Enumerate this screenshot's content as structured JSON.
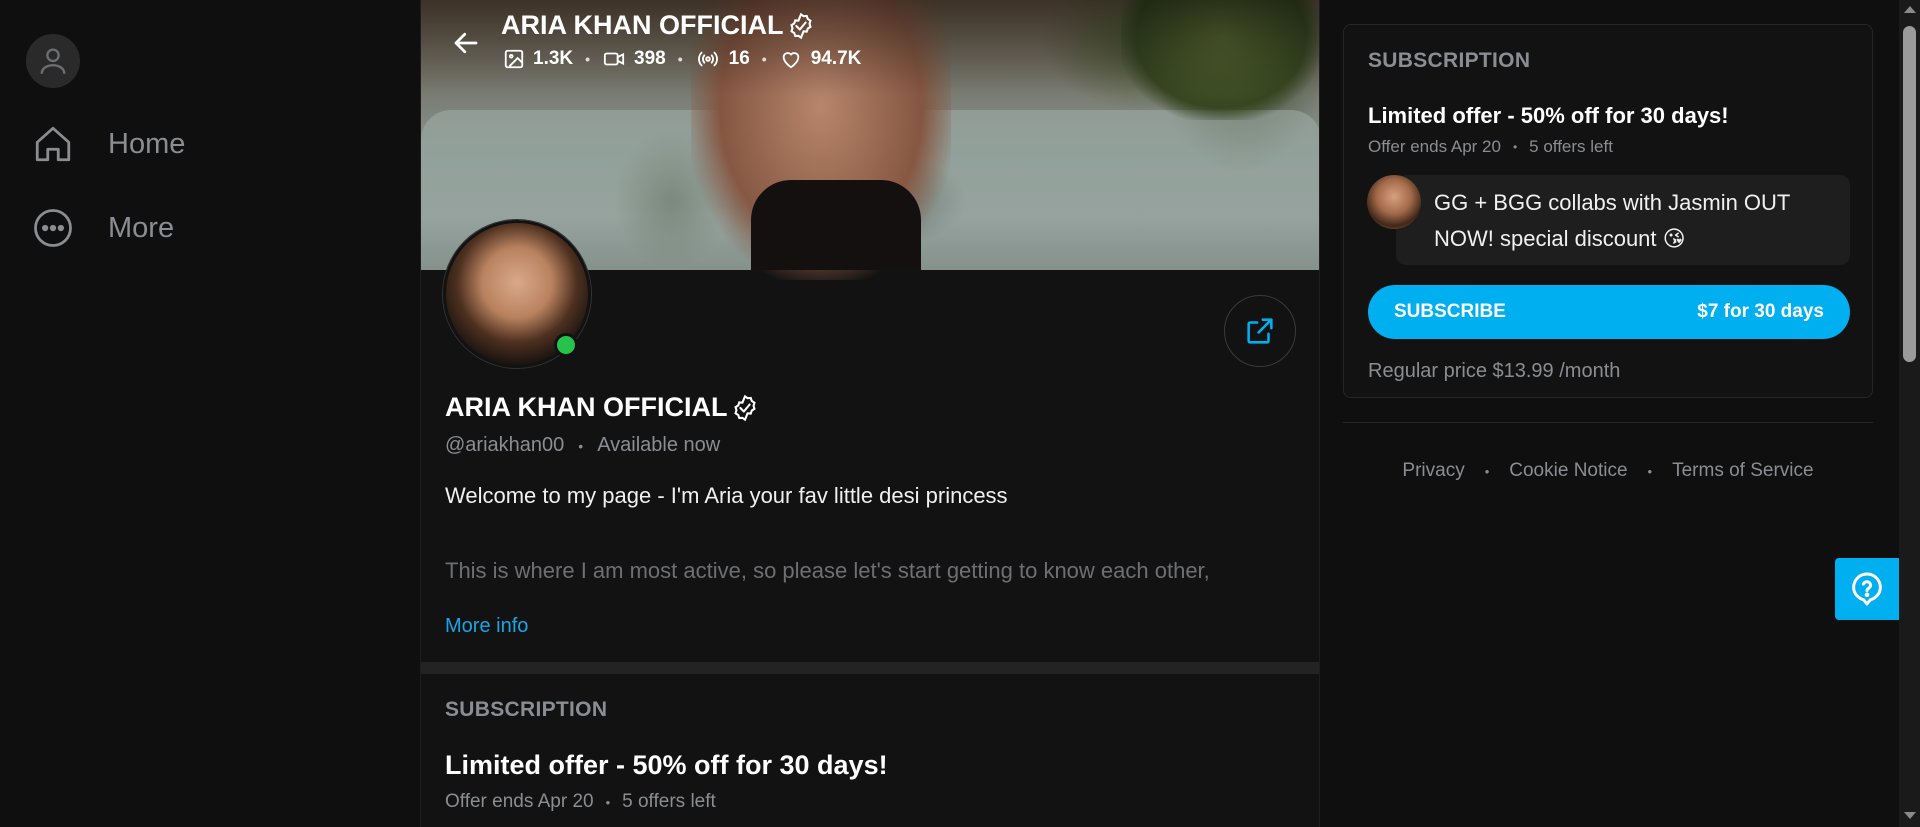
{
  "sidebar": {
    "items": [
      {
        "label": "Home",
        "icon": "home-icon"
      },
      {
        "label": "More",
        "icon": "more-icon"
      }
    ]
  },
  "profile": {
    "name": "ARIA KHAN OFFICIAL",
    "handle": "@ariakhan00",
    "status": "Available now",
    "stats": {
      "photos": "1.3K",
      "videos": "398",
      "streams": "16",
      "likes": "94.7K"
    },
    "bio_line1": "Welcome to my page - I'm Aria your fav little desi princess",
    "bio_line2": "This is where I am most active, so please let's start getting to know each other,",
    "more_info": "More info"
  },
  "subscription": {
    "heading": "SUBSCRIPTION",
    "offer_title": "Limited offer - 50% off for 30 days!",
    "offer_ends": "Offer ends Apr 20",
    "offers_left": "5 offers left",
    "promo_message": "GG + BGG collabs with Jasmin OUT NOW! special discount 😘",
    "subscribe_label": "SUBSCRIBE",
    "subscribe_price": "$7 for 30 days",
    "regular_price": "Regular price $13.99 /month"
  },
  "footer": {
    "privacy": "Privacy",
    "cookie": "Cookie Notice",
    "terms": "Terms of Service"
  },
  "colors": {
    "accent": "#00aff0",
    "background": "#0f0f0f",
    "online": "#27c24c",
    "muted_text": "#8a8d92"
  }
}
